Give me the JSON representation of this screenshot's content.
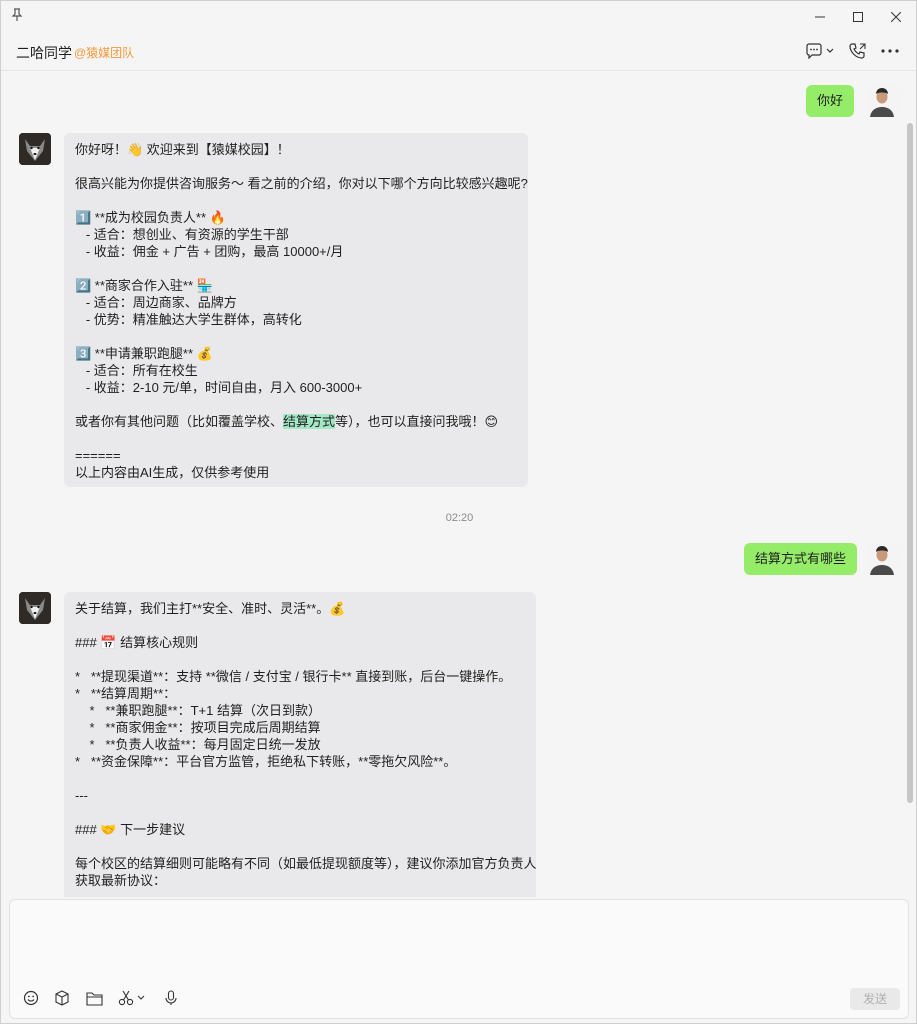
{
  "window": {
    "pin_icon": "pin-icon",
    "minimize_icon": "minimize-icon",
    "maximize_icon": "maximize-icon",
    "close_icon": "close-icon"
  },
  "header": {
    "chat_name": "二哈同学",
    "tag": "@猿媒团队"
  },
  "messages": {
    "user1": "你好",
    "bot1": [
      "你好呀！👋 欢迎来到【猿媒校园】！",
      "",
      "很高兴能为你提供咨询服务～ 看之前的介绍，你对以下哪个方向比较感兴趣呢?",
      "",
      "1️⃣ **成为校园负责人** 🔥",
      "   - 适合：想创业、有资源的学生干部",
      "   - 收益：佣金 + 广告 + 团购，最高 10000+/月",
      "",
      "2️⃣ **商家合作入驻** 🏪",
      "   - 适合：周边商家、品牌方",
      "   - 优势：精准触达大学生群体，高转化",
      "",
      "3️⃣ **申请兼职跑腿** 💰",
      "   - 适合：所有在校生",
      "   - 收益：2-10 元/单，时间自由，月入 600-3000+",
      "",
      "或者你有其他问题（比如覆盖学校、",
      "",
      "======",
      "以上内容由AI生成，仅供参考使用"
    ],
    "bot1_q_highlight": "结算方式",
    "bot1_q_tail": "等），也可以直接问我哦！😊",
    "time1": "02:20",
    "user2": "结算方式有哪些",
    "bot2": [
      "关于结算，我们主打**安全、准时、灵活**。💰",
      "",
      "### 📅 结算核心规则",
      "",
      "*   **提现渠道**：支持 **微信 / 支付宝 / 银行卡** 直接到账，后台一键操作。",
      "*   **结算周期**：",
      "    *   **兼职跑腿**：T+1 结算（次日到款）",
      "    *   **商家佣金**：按项目完成后周期结算",
      "    *   **负责人收益**：每月固定日统一发放",
      "*   **资金保障**：平台官方监管，拒绝私下转账，**零拖欠风险**。",
      "",
      "---",
      "",
      "### 🤝 下一步建议",
      "",
      "每个校区的结算细则可能略有不同（如最低提现额度等），建议你添加官方负责人",
      "获取最新协议："
    ]
  },
  "composer": {
    "send_label": "发送",
    "tools": [
      "emoji-icon",
      "box-icon",
      "folder-icon",
      "scissors-icon",
      "microphone-icon"
    ]
  },
  "colors": {
    "user_bubble": "#95ec69",
    "bot_bubble": "#e9e9eb",
    "tag": "#f29a3c",
    "highlight": "#a5e8c8"
  }
}
